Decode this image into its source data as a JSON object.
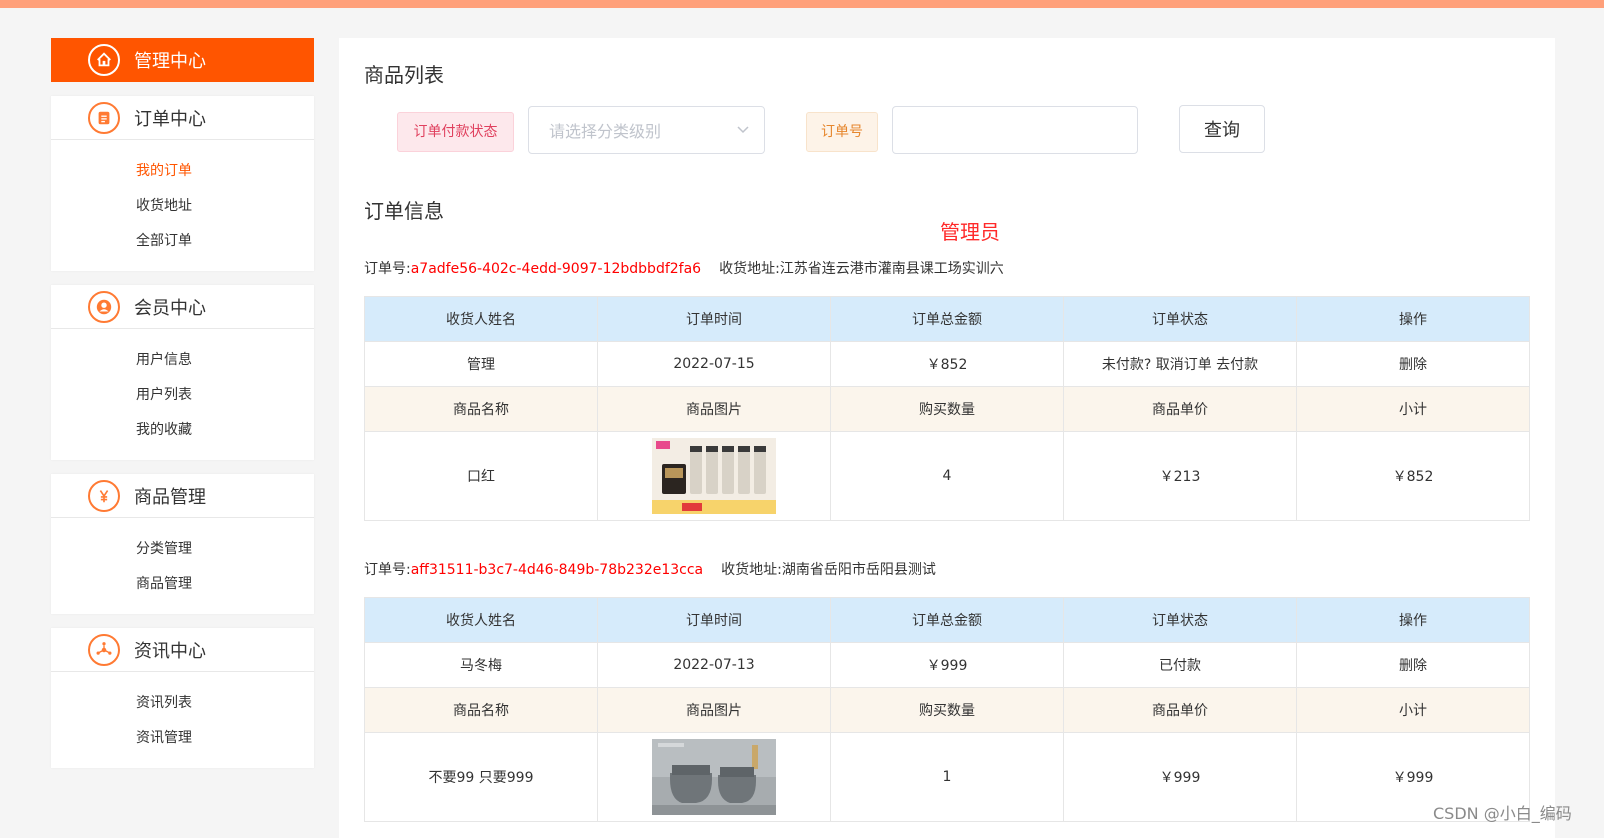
{
  "sidebar": {
    "home": {
      "label": "管理中心",
      "icon": "home-icon"
    },
    "groups": [
      {
        "title": "订单中心",
        "icon": "clipboard-icon",
        "items": [
          {
            "label": "我的订单",
            "active": true
          },
          {
            "label": "收货地址"
          },
          {
            "label": "全部订单"
          }
        ]
      },
      {
        "title": "会员中心",
        "icon": "user-icon",
        "items": [
          {
            "label": "用户信息"
          },
          {
            "label": "用户列表"
          },
          {
            "label": "我的收藏"
          }
        ]
      },
      {
        "title": "商品管理",
        "icon": "yen-icon",
        "items": [
          {
            "label": "分类管理"
          },
          {
            "label": "商品管理"
          }
        ]
      },
      {
        "title": "资讯中心",
        "icon": "share-icon",
        "items": [
          {
            "label": "资讯列表"
          },
          {
            "label": "资讯管理"
          }
        ]
      }
    ]
  },
  "main": {
    "list_title": "商品列表",
    "filter": {
      "status_tag": "订单付款状态",
      "status_placeholder": "请选择分类级别",
      "order_no_tag": "订单号",
      "order_no_value": "",
      "query_button": "查询"
    },
    "info_title": "订单信息",
    "role": "管理员",
    "labels": {
      "order_no": "订单号:",
      "address": "收货地址:",
      "order_header": [
        "收货人姓名",
        "订单时间",
        "订单总金额",
        "订单状态",
        "操作"
      ],
      "item_header": [
        "商品名称",
        "商品图片",
        "购买数量",
        "商品单价",
        "小计"
      ]
    },
    "orders": [
      {
        "order_no": "a7adfe56-402c-4edd-9097-12bdbbdf2fa6",
        "address": "江苏省连云港市灌南县课工场实训六",
        "receiver": "管理",
        "time": "2022-07-15",
        "total": "￥852",
        "status": "未付款? 取消订单 去付款",
        "action": "删除",
        "item": {
          "name": "口红",
          "image": "cosmetics-product-image",
          "qty": "4",
          "price": "￥213",
          "subtotal": "￥852"
        }
      },
      {
        "order_no": "aff31511-b3c7-4d46-849b-78b232e13cca",
        "address": "湖南省岳阳市岳阳县测试",
        "receiver": "马冬梅",
        "time": "2022-07-13",
        "total": "￥999",
        "status": "已付款",
        "action": "删除",
        "item": {
          "name": "不要99 只要999",
          "image": "toilet-product-image",
          "qty": "1",
          "price": "￥999",
          "subtotal": "￥999"
        }
      }
    ]
  },
  "watermark": "CSDN @小白_编码",
  "colors": {
    "accent": "#ff5500",
    "header_blue": "#d6ebfb",
    "header_cream": "#fbf5ec",
    "topbar": "#ffa07a",
    "red_text": "#ff0000"
  }
}
